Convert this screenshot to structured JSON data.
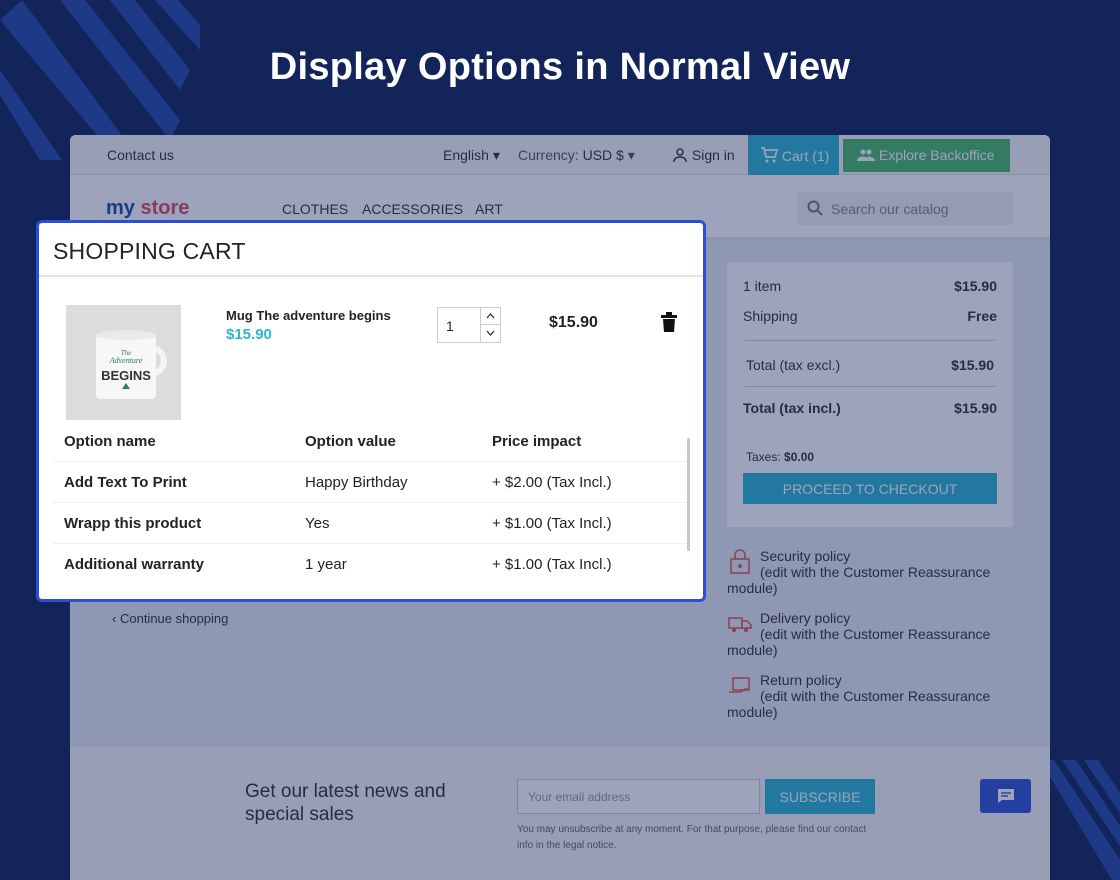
{
  "hero": {
    "title": "Display Options in Normal View"
  },
  "topbar": {
    "contact": "Contact us",
    "language": "English",
    "currency_label": "Currency:",
    "currency_value": "USD $",
    "signin": "Sign in",
    "cart": "Cart (1)",
    "backoffice": "Explore Backoffice"
  },
  "nav": {
    "logo_a": "my",
    "logo_b": "store",
    "menu": [
      "CLOTHES",
      "ACCESSORIES",
      "ART"
    ],
    "search_placeholder": "Search our catalog"
  },
  "summary": {
    "items_label": "1 item",
    "items_value": "$15.90",
    "shipping_label": "Shipping",
    "shipping_value": "Free",
    "total_excl_label": "Total (tax excl.)",
    "total_excl_value": "$15.90",
    "total_incl_label": "Total (tax incl.)",
    "total_incl_value": "$15.90",
    "taxes_label": "Taxes:",
    "taxes_value": "$0.00",
    "checkout": "PROCEED TO CHECKOUT"
  },
  "reassurance": [
    {
      "title": "Security policy",
      "desc": "(edit with the Customer Reassurance module)"
    },
    {
      "title": "Delivery policy",
      "desc": "(edit with the Customer Reassurance module)"
    },
    {
      "title": "Return policy",
      "desc": "(edit with the Customer Reassurance module)"
    }
  ],
  "continue_shopping": "Continue shopping",
  "newsletter": {
    "title": "Get our latest news and special sales",
    "placeholder": "Your email address",
    "button": "SUBSCRIBE",
    "note": "You may unsubscribe at any moment. For that purpose, please find our contact info in the legal notice."
  },
  "cart_modal": {
    "title": "SHOPPING CART",
    "product": {
      "name": "Mug The adventure begins",
      "price": "$15.90",
      "quantity": "1",
      "line_total": "$15.90"
    },
    "options_headers": [
      "Option name",
      "Option value",
      "Price impact"
    ],
    "options": [
      {
        "name": "Add Text To Print",
        "value": "Happy Birthday",
        "impact": "+ $2.00 (Tax Incl.)"
      },
      {
        "name": "Wrapp this product",
        "value": "Yes",
        "impact": "+ $1.00 (Tax Incl.)"
      },
      {
        "name": "Additional warranty",
        "value": "1 year",
        "impact": "+ $1.00 (Tax Incl.)"
      }
    ],
    "mug_text_a": "The",
    "mug_text_b": "Adventure",
    "mug_text_c": "BEGINS"
  },
  "colors": {
    "background": "#12245a",
    "accent": "#2fb5d2",
    "modal_border": "#2b4fdb",
    "backoffice_green": "#4cbb6c"
  }
}
